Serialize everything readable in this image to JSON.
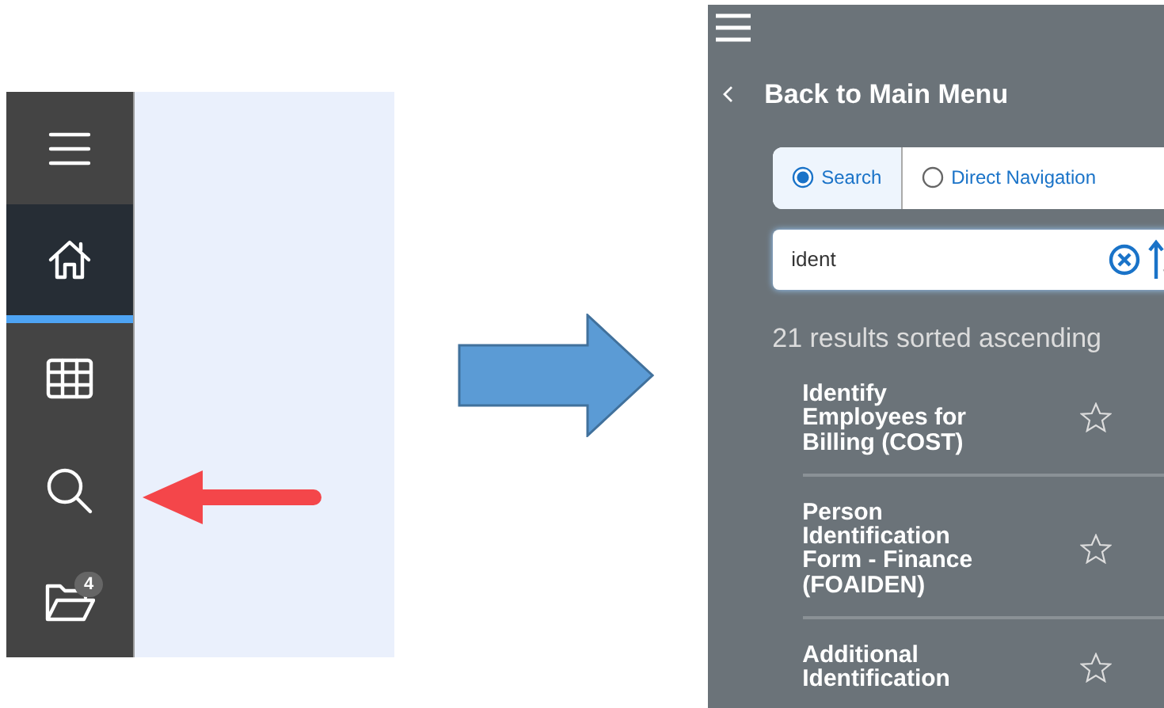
{
  "sidebar": {
    "items": [
      {
        "kind": "menu",
        "selected": false
      },
      {
        "kind": "home",
        "selected": true
      },
      {
        "kind": "grid",
        "selected": false
      },
      {
        "kind": "search",
        "selected": false
      },
      {
        "kind": "folder",
        "selected": false,
        "badge": "4"
      }
    ]
  },
  "search_panel": {
    "back_label": "Back to Main Menu",
    "modes": [
      {
        "label": "Search",
        "selected": true
      },
      {
        "label": "Direct Navigation",
        "selected": false
      }
    ],
    "search": {
      "value": "ident"
    },
    "results_summary": "21 results sorted ascending",
    "results": [
      {
        "title": "Identify Employees for Billing (COST)",
        "favorite": false
      },
      {
        "title": "Person Identification Form - Finance (FOAIDEN)",
        "favorite": false
      },
      {
        "title": "Additional Identification",
        "favorite": false
      }
    ]
  }
}
